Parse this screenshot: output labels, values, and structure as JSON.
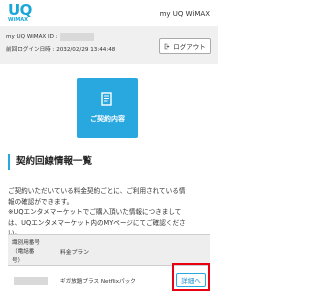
{
  "header": {
    "logo_main": "UQ",
    "logo_sub": "WiMAX",
    "title": "my UQ WiMAX"
  },
  "user": {
    "id_label": "my UQ WiMAX ID :",
    "last_login": "前回ログイン日時 : 2032/02/29 13:44:48",
    "logout_label": "ログアウト"
  },
  "main": {
    "contract_button_label": "ご契約内容",
    "section_title": "契約回線情報一覧",
    "description_lines": [
      "ご契約いただいている料金契約ごとに、ご利用されている情",
      "報の確認ができます。",
      "※UQエンタメマーケットでご購入頂いた情報につきまして",
      "は、UQエンタメマーケット内のMYページにてご確認くださ",
      "い。"
    ]
  },
  "table": {
    "col1_header_lines": [
      "識別用番号",
      "（電話番",
      "号）"
    ],
    "col2_header": "料金プラン",
    "rows": [
      {
        "plan": "ギガ放題プラス Netflixパック",
        "detail_label": "詳細へ"
      }
    ]
  },
  "colors": {
    "accent": "#29a8e0",
    "highlight": "#e60012",
    "user_bar_bg": "#f0f0f0"
  },
  "icons": {
    "logout": "logout-arrow-icon",
    "contract": "document-icon"
  }
}
